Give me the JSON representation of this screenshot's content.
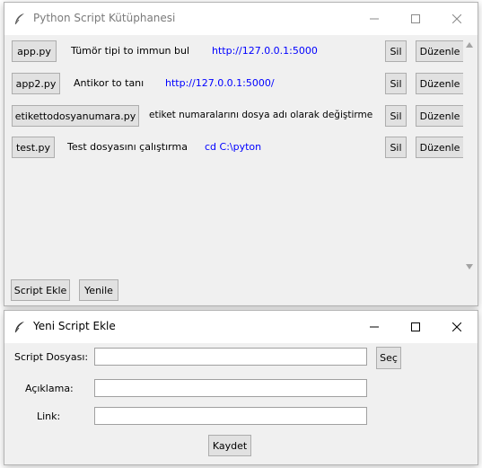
{
  "main_window": {
    "title": "Python Script Kütüphanesi",
    "scripts": [
      {
        "file": "app.py",
        "description": "Tümör tipi to immun bul",
        "command": "http://127.0.0.1:5000"
      },
      {
        "file": "app2.py",
        "description": "Antikor to tanı",
        "command": "http://127.0.0.1:5000/"
      },
      {
        "file": "etikettodosyanumara.py",
        "description": "etiket numaralarını dosya adı olarak değiştirme",
        "command": ""
      },
      {
        "file": "test.py",
        "description": "Test dosyasını çalıştırma",
        "command": "cd C:\\pyton"
      }
    ],
    "delete_label": "Sil",
    "edit_label": "Düzenle",
    "add_script_label": "Script Ekle",
    "refresh_label": "Yenile"
  },
  "dialog": {
    "title": "Yeni Script Ekle",
    "script_file_label": "Script Dosyası:",
    "script_file_value": "",
    "browse_label": "Seç",
    "description_label": "Açıklama:",
    "description_value": "",
    "link_label": "Link:",
    "link_value": "",
    "save_label": "Kaydet"
  },
  "colors": {
    "link": "#0000ff",
    "window_bg": "#f0f0f0",
    "button_bg": "#e1e1e1"
  }
}
